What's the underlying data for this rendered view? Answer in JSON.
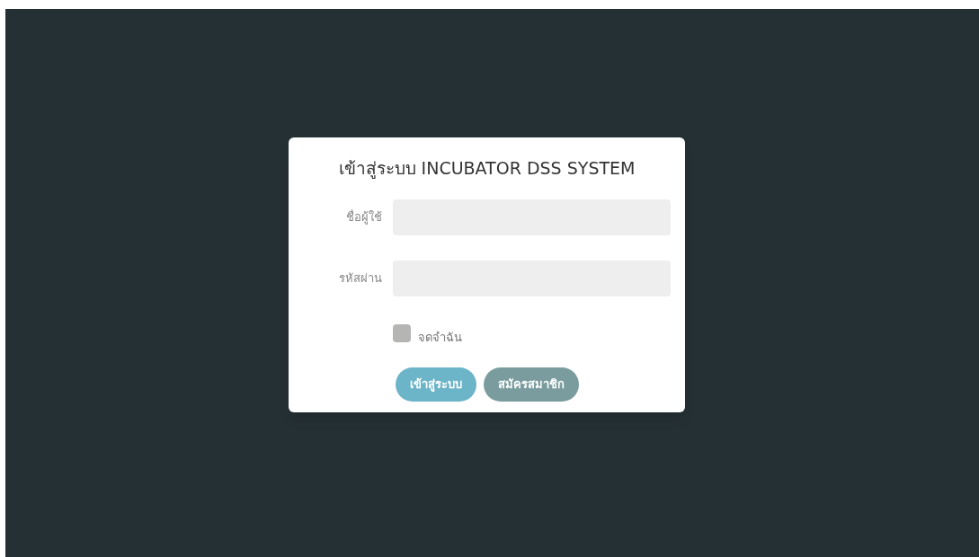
{
  "login_form": {
    "title": "เข้าสู่ระบบ INCUBATOR DSS SYSTEM",
    "fields": [
      {
        "label": "ชื่อผู้ใช้"
      },
      {
        "label": "รหัสผ่าน"
      }
    ],
    "remember": {
      "label": "จดจำฉัน",
      "checked": false
    },
    "buttons": [
      {
        "label": "เข้าสู่ระบบ",
        "kind": "primary"
      },
      {
        "label": "สมัครสมาชิก",
        "kind": "secondary"
      }
    ]
  }
}
